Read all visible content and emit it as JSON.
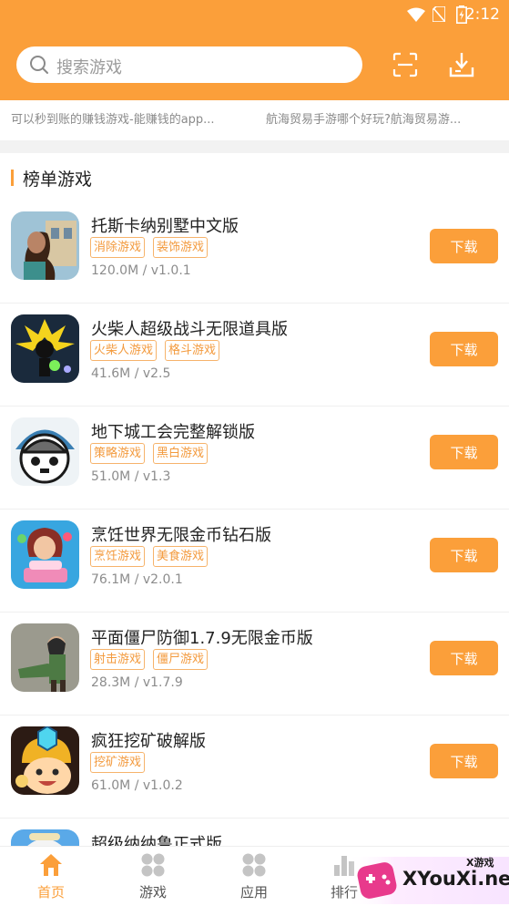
{
  "status_bar": {
    "time": "2:12"
  },
  "search": {
    "placeholder": "搜索游戏"
  },
  "news": [
    "可以秒到账的赚钱游戏-能赚钱的app...",
    "航海贸易手游哪个好玩?航海贸易游..."
  ],
  "section": {
    "title": "榜单游戏"
  },
  "games": [
    {
      "name": "托斯卡纳别墅中文版",
      "tags": [
        "消除游戏",
        "装饰游戏"
      ],
      "meta": "120.0M / v1.0.1",
      "button": "下载",
      "icon": "villa-icon"
    },
    {
      "name": "火柴人超级战斗无限道具版",
      "tags": [
        "火柴人游戏",
        "格斗游戏"
      ],
      "meta": "41.6M / v2.5",
      "button": "下载",
      "icon": "stickman-icon"
    },
    {
      "name": "地下城工会完整解锁版",
      "tags": [
        "策略游戏",
        "黑白游戏"
      ],
      "meta": "51.0M / v1.3",
      "button": "下载",
      "icon": "dungeon-icon"
    },
    {
      "name": "烹饪世界无限金币钻石版",
      "tags": [
        "烹饪游戏",
        "美食游戏"
      ],
      "meta": "76.1M / v2.0.1",
      "button": "下载",
      "icon": "cooking-icon"
    },
    {
      "name": "平面僵尸防御1.7.9无限金币版",
      "tags": [
        "射击游戏",
        "僵尸游戏"
      ],
      "meta": "28.3M / v1.7.9",
      "button": "下载",
      "icon": "zombie-icon"
    },
    {
      "name": "疯狂挖矿破解版",
      "tags": [
        "挖矿游戏"
      ],
      "meta": "61.0M / v1.0.2",
      "button": "下载",
      "icon": "miner-icon"
    },
    {
      "name": "超级纳纳鲁正式版",
      "tags": [],
      "meta": "",
      "button": "",
      "icon": "nanaru-icon"
    }
  ],
  "tabs": [
    {
      "label": "首页",
      "icon": "home-icon",
      "active": true
    },
    {
      "label": "游戏",
      "icon": "grid-icon",
      "active": false
    },
    {
      "label": "应用",
      "icon": "apps-icon",
      "active": false
    },
    {
      "label": "排行",
      "icon": "rank-icon",
      "active": false
    }
  ],
  "watermark": {
    "main": "XYouXi.net",
    "sub": "X游戏"
  },
  "colors": {
    "accent": "#fb9f3a",
    "tag": "#f39a3d"
  }
}
